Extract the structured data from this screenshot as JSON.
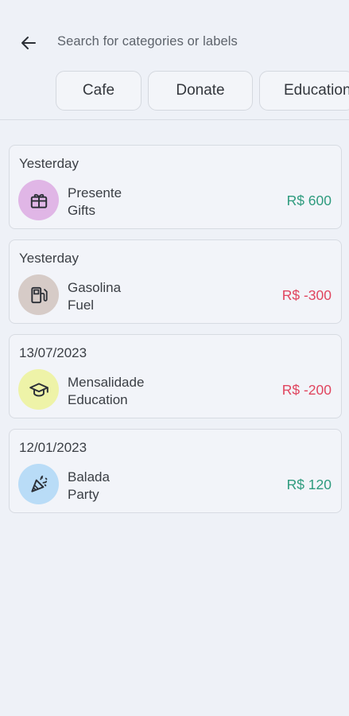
{
  "header": {
    "back_icon": "arrow-left-icon",
    "search_placeholder": "Search for categories or labels"
  },
  "chips": [
    {
      "label": "Cafe"
    },
    {
      "label": "Donate"
    },
    {
      "label": "Education"
    }
  ],
  "transactions": [
    {
      "date": "Yesterday",
      "name": "Presente",
      "category": "Gifts",
      "amount": "R$ 600",
      "type": "income",
      "icon": "gift-icon",
      "icon_bg": "#e0b6e6"
    },
    {
      "date": "Yesterday",
      "name": "Gasolina",
      "category": "Fuel",
      "amount": "R$ -300",
      "type": "expense",
      "icon": "fuel-pump-icon",
      "icon_bg": "#d6cbc7"
    },
    {
      "date": "13/07/2023",
      "name": "Mensalidade",
      "category": "Education",
      "amount": "R$ -200",
      "type": "expense",
      "icon": "graduation-cap-icon",
      "icon_bg": "#eef3a8"
    },
    {
      "date": "12/01/2023",
      "name": "Balada",
      "category": "Party",
      "amount": "R$ 120",
      "type": "income",
      "icon": "party-popper-icon",
      "icon_bg": "#b9dcf7"
    }
  ],
  "colors": {
    "income": "#2e9b7e",
    "expense": "#e0455f",
    "background": "#eef1f7"
  }
}
